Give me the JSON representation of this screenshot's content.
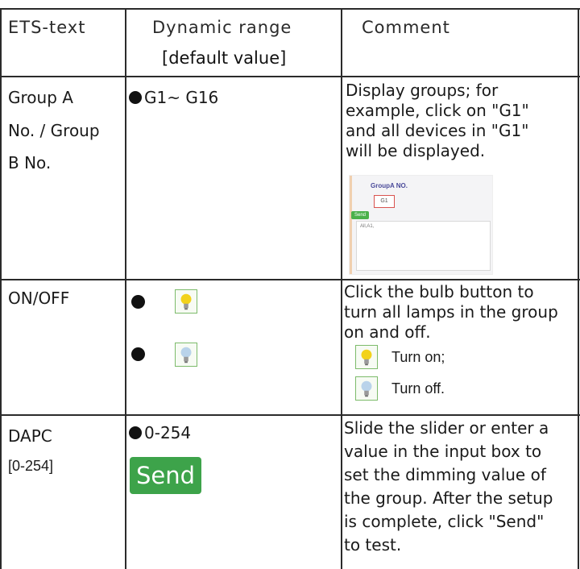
{
  "header": {
    "col1": "ETS-text",
    "col2_line1": "Dynamic range",
    "col2_line2": "[default value]",
    "col3": "Comment"
  },
  "rows": [
    {
      "ets_lines": [
        "Group A",
        "No. / Group",
        "B No."
      ],
      "range": "G1~ G16",
      "comment_lines": [
        "Display groups; for",
        "example, click on \"G1\"",
        "and all devices in \"G1\"",
        "will be displayed."
      ],
      "thumb": {
        "title": "GroupA NO.",
        "selected": "G1",
        "send": "Send",
        "area_text": "All,A1,"
      }
    },
    {
      "ets": "ON/OFF",
      "comment_lines": [
        "Click the bulb button to",
        "turn all lamps in the group",
        "on and off."
      ],
      "legend_on": "Turn on;",
      "legend_off": "Turn off.",
      "icons": [
        "bulb-on-icon",
        "bulb-off-icon"
      ]
    },
    {
      "ets_lines": [
        "DAPC",
        "[0-254]"
      ],
      "range": "0-254",
      "button": "Send",
      "comment_lines": [
        "Slide the slider or enter a",
        "value in the input box to",
        "set the dimming value of",
        "the group. After the setup",
        "is complete, click \"Send\"",
        "to test."
      ]
    }
  ],
  "colors": {
    "send_bg": "#3da34a",
    "bulb_on": "#f2d21b",
    "bulb_off": "#b9d3ea",
    "icon_border": "#7dbb6b"
  }
}
